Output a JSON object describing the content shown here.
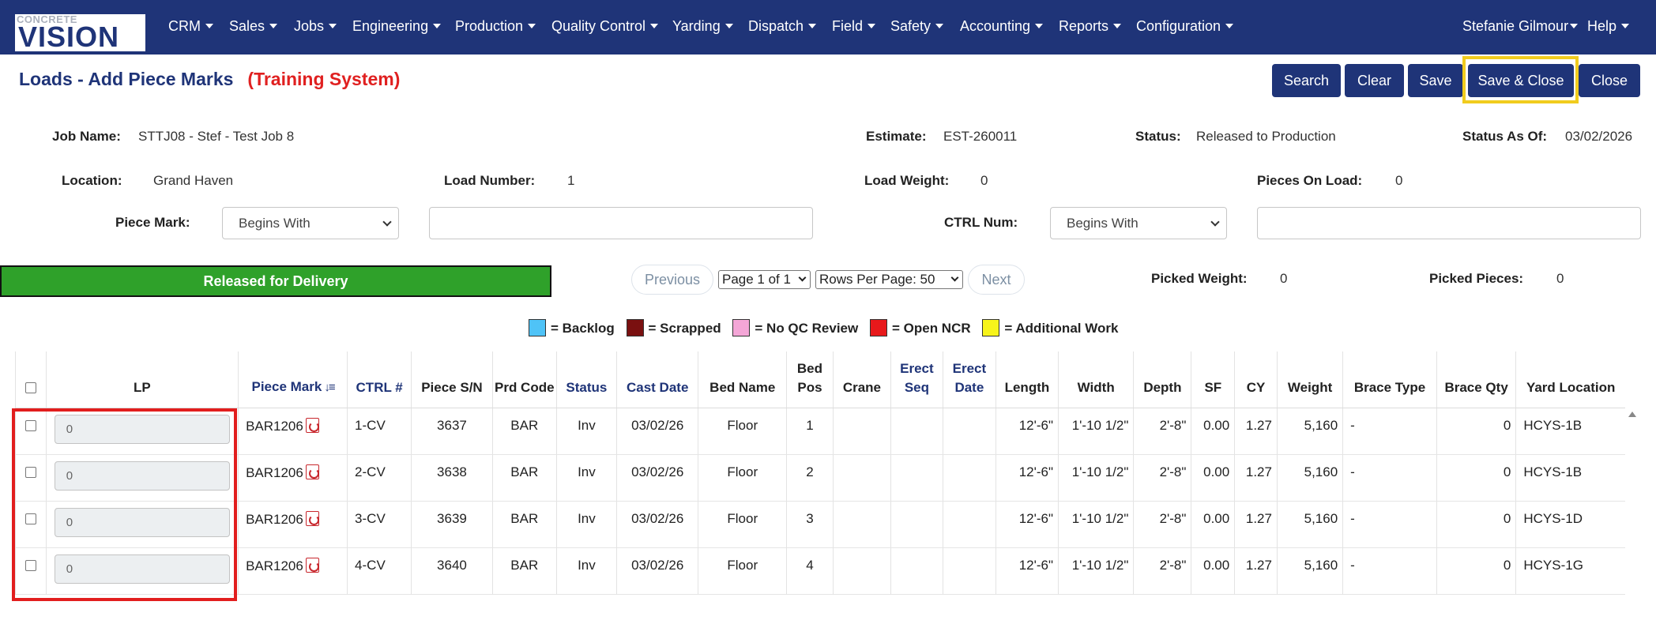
{
  "nav": {
    "logo_top": "CONCRETE",
    "logo_main": "VISION",
    "items": [
      "CRM",
      "Sales",
      "Jobs",
      "Engineering",
      "Production",
      "Quality Control",
      "Yarding",
      "Dispatch",
      "Field",
      "Safety",
      "Accounting",
      "Reports",
      "Configuration"
    ],
    "user": "Stefanie Gilmour",
    "help": "Help"
  },
  "page": {
    "title": "Loads - Add Piece Marks",
    "training": "(Training System)"
  },
  "buttons": {
    "search": "Search",
    "clear": "Clear",
    "save": "Save",
    "save_close": "Save & Close",
    "close": "Close"
  },
  "info": {
    "job_name_label": "Job Name:",
    "job_name": "STTJ08 - Stef - Test Job 8",
    "estimate_label": "Estimate:",
    "estimate": "EST-260011",
    "status_label": "Status:",
    "status": "Released to Production",
    "status_as_of_label": "Status As Of:",
    "status_as_of": "03/02/2026",
    "location_label": "Location:",
    "location": "Grand Haven",
    "load_number_label": "Load Number:",
    "load_number": "1",
    "load_weight_label": "Load Weight:",
    "load_weight": "0",
    "pieces_on_load_label": "Pieces On Load:",
    "pieces_on_load": "0"
  },
  "filters": {
    "piece_mark_label": "Piece Mark:",
    "piece_mark_mode": "Begins With",
    "ctrl_num_label": "CTRL Num:",
    "ctrl_num_mode": "Begins With"
  },
  "release_status": "Released for Delivery",
  "pager": {
    "previous": "Previous",
    "page": "Page 1 of 1",
    "rows_per_page": "Rows Per Page: 50",
    "next": "Next"
  },
  "picked": {
    "weight_label": "Picked Weight:",
    "weight": "0",
    "pieces_label": "Picked Pieces:",
    "pieces": "0"
  },
  "legend": [
    {
      "label": "= Backlog",
      "color": "#4fc3f7"
    },
    {
      "label": "= Scrapped",
      "color": "#7a1010"
    },
    {
      "label": "= No QC Review",
      "color": "#f4a6d7"
    },
    {
      "label": "= Open NCR",
      "color": "#e8191b"
    },
    {
      "label": "= Additional Work",
      "color": "#f7f41b"
    }
  ],
  "table": {
    "headers": {
      "lp": "LP",
      "piece_mark": "Piece Mark",
      "ctrl": "CTRL #",
      "piece_sn": "Piece S/N",
      "prd_code": "Prd Code",
      "status": "Status",
      "cast_date": "Cast Date",
      "bed_name": "Bed Name",
      "bed_pos": "Bed Pos",
      "crane": "Crane",
      "erect_seq": "Erect Seq",
      "erect_date": "Erect Date",
      "length": "Length",
      "width": "Width",
      "depth": "Depth",
      "sf": "SF",
      "cy": "CY",
      "weight": "Weight",
      "brace_type": "Brace Type",
      "brace_qty": "Brace Qty",
      "yard_location": "Yard Location"
    },
    "rows": [
      {
        "lp": "0",
        "piece_mark": "BAR1206",
        "ctrl": "1-CV",
        "piece_sn": "3637",
        "prd_code": "BAR",
        "status": "Inv",
        "cast_date": "03/02/26",
        "bed_name": "Floor",
        "bed_pos": "1",
        "crane": "",
        "erect_seq": "",
        "erect_date": "",
        "length": "12'-6\"",
        "width": "1'-10 1/2\"",
        "depth": "2'-8\"",
        "sf": "0.00",
        "cy": "1.27",
        "weight": "5,160",
        "brace_type": "-",
        "brace_qty": "0",
        "yard_location": "HCYS-1B"
      },
      {
        "lp": "0",
        "piece_mark": "BAR1206",
        "ctrl": "2-CV",
        "piece_sn": "3638",
        "prd_code": "BAR",
        "status": "Inv",
        "cast_date": "03/02/26",
        "bed_name": "Floor",
        "bed_pos": "2",
        "crane": "",
        "erect_seq": "",
        "erect_date": "",
        "length": "12'-6\"",
        "width": "1'-10 1/2\"",
        "depth": "2'-8\"",
        "sf": "0.00",
        "cy": "1.27",
        "weight": "5,160",
        "brace_type": "-",
        "brace_qty": "0",
        "yard_location": "HCYS-1B"
      },
      {
        "lp": "0",
        "piece_mark": "BAR1206",
        "ctrl": "3-CV",
        "piece_sn": "3639",
        "prd_code": "BAR",
        "status": "Inv",
        "cast_date": "03/02/26",
        "bed_name": "Floor",
        "bed_pos": "3",
        "crane": "",
        "erect_seq": "",
        "erect_date": "",
        "length": "12'-6\"",
        "width": "1'-10 1/2\"",
        "depth": "2'-8\"",
        "sf": "0.00",
        "cy": "1.27",
        "weight": "5,160",
        "brace_type": "-",
        "brace_qty": "0",
        "yard_location": "HCYS-1D"
      },
      {
        "lp": "0",
        "piece_mark": "BAR1206",
        "ctrl": "4-CV",
        "piece_sn": "3640",
        "prd_code": "BAR",
        "status": "Inv",
        "cast_date": "03/02/26",
        "bed_name": "Floor",
        "bed_pos": "4",
        "crane": "",
        "erect_seq": "",
        "erect_date": "",
        "length": "12'-6\"",
        "width": "1'-10 1/2\"",
        "depth": "2'-8\"",
        "sf": "0.00",
        "cy": "1.27",
        "weight": "5,160",
        "brace_type": "-",
        "brace_qty": "0",
        "yard_location": "HCYS-1G"
      }
    ]
  }
}
